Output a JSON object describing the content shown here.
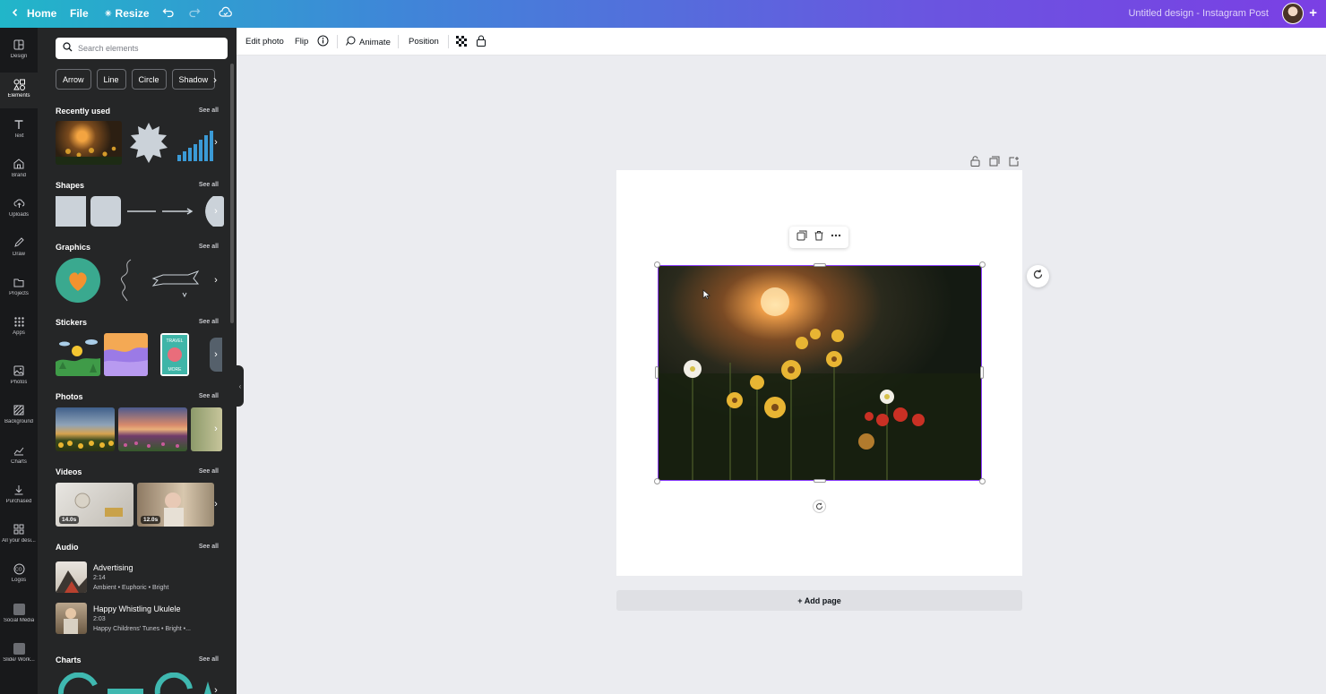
{
  "topbar": {
    "home_label": "Home",
    "file_label": "File",
    "resize_label": "Resize",
    "design_title": "Untitled design - Instagram Post"
  },
  "rail": [
    {
      "label": "Design",
      "icon": "layout-icon"
    },
    {
      "label": "Elements",
      "icon": "shapes-icon"
    },
    {
      "label": "Text",
      "icon": "text-icon"
    },
    {
      "label": "Brand",
      "icon": "brand-icon"
    },
    {
      "label": "Uploads",
      "icon": "cloud-upload-icon"
    },
    {
      "label": "Draw",
      "icon": "pen-icon"
    },
    {
      "label": "Projects",
      "icon": "folder-icon"
    },
    {
      "label": "Apps",
      "icon": "grid-icon"
    },
    {
      "label": "Photos",
      "icon": "image-icon"
    },
    {
      "label": "Background",
      "icon": "background-icon"
    },
    {
      "label": "Charts",
      "icon": "chart-icon"
    },
    {
      "label": "Purchased",
      "icon": "download-icon"
    },
    {
      "label": "All your desi...",
      "icon": "designs-icon"
    },
    {
      "label": "Logos",
      "icon": "logo-icon"
    },
    {
      "label": "Social Media",
      "icon": "social-icon"
    },
    {
      "label": "Slide/ Work...",
      "icon": "slide-icon"
    }
  ],
  "panel": {
    "search_placeholder": "Search elements",
    "chips": [
      "Arrow",
      "Line",
      "Circle",
      "Shadow"
    ],
    "see_all": "See all",
    "sections": {
      "recent": "Recently used",
      "shapes": "Shapes",
      "graphics": "Graphics",
      "stickers": "Stickers",
      "photos": "Photos",
      "videos": "Videos",
      "audio": "Audio",
      "charts": "Charts"
    },
    "videos": [
      {
        "duration": "14.0s"
      },
      {
        "duration": "12.0s"
      }
    ],
    "audio": [
      {
        "title": "Advertising",
        "length": "2:14",
        "tags": "Ambient • Euphoric • Bright"
      },
      {
        "title": "Happy Whistling Ukulele",
        "length": "2:03",
        "tags": "Happy Childrens' Tunes • Bright •..."
      }
    ]
  },
  "context_toolbar": {
    "edit_photo": "Edit photo",
    "flip": "Flip",
    "animate": "Animate",
    "position": "Position"
  },
  "canvas": {
    "add_page": "+ Add page"
  },
  "colors": {
    "accent": "#8b3dff",
    "panel_bg": "#252627",
    "rail_bg": "#18191b"
  }
}
